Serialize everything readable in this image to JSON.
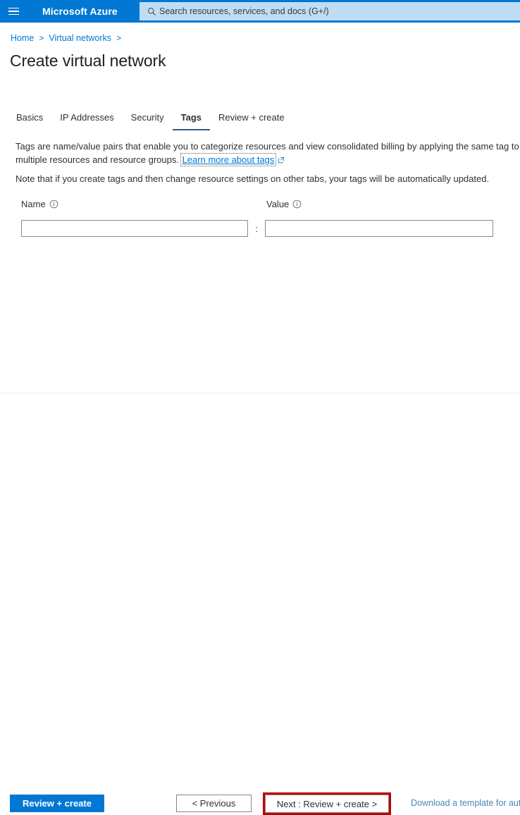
{
  "topbar": {
    "menu_icon": "hamburger-icon",
    "brand": "Microsoft Azure",
    "search": {
      "icon": "search-icon",
      "placeholder": "Search resources, services, and docs (G+/)",
      "value": ""
    },
    "background_color": "#0078d4",
    "search_background_color": "#bfddf5"
  },
  "breadcrumb": {
    "items": [
      {
        "label": "Home"
      },
      {
        "label": "Virtual networks"
      }
    ],
    "separator": ">"
  },
  "page": {
    "title": "Create virtual network"
  },
  "tabs": [
    {
      "label": "Basics",
      "active": false
    },
    {
      "label": "IP Addresses",
      "active": false
    },
    {
      "label": "Security",
      "active": false
    },
    {
      "label": "Tags",
      "active": true
    },
    {
      "label": "Review + create",
      "active": false
    }
  ],
  "content": {
    "description_part1": "Tags are name/value pairs that enable you to categorize resources and view consolidated billing by applying the same tag to multiple resources and resource groups.",
    "learn_more_link": "Learn more about tags",
    "learn_more_icon": "external-link-icon",
    "note": "Note that if you create tags and then change resource settings on other tabs, your tags will be automatically updated.",
    "columns": {
      "name_label": "Name",
      "name_info_icon": "info-icon",
      "value_label": "Value",
      "value_info_icon": "info-icon"
    },
    "separator": ":",
    "rows": [
      {
        "name": "",
        "value": ""
      }
    ]
  },
  "footer": {
    "review_create_label": "Review + create",
    "previous_label": "< Previous",
    "next_label": "Next : Review + create >",
    "download_template_label": "Download a template for automation",
    "highlight_color": "#c00000",
    "primary_color": "#0078d4"
  }
}
